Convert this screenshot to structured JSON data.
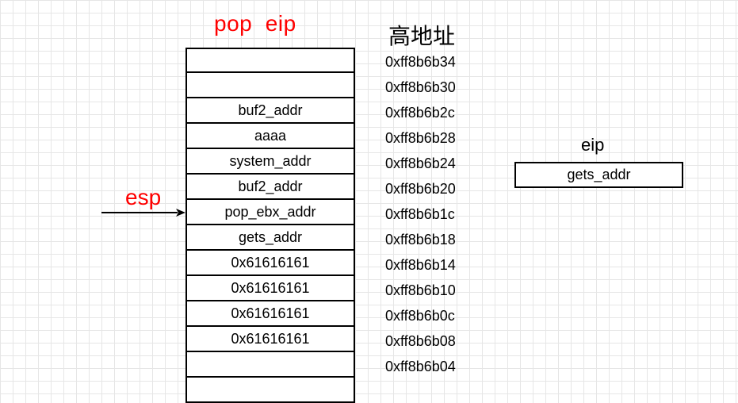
{
  "title_left": "pop  eip",
  "title_right": "高地址",
  "stack": {
    "cells": [
      "",
      "",
      "buf2_addr",
      "aaaa",
      "system_addr",
      "buf2_addr",
      "pop_ebx_addr",
      "gets_addr",
      "0x61616161",
      "0x61616161",
      "0x61616161",
      "0x61616161",
      "",
      ""
    ]
  },
  "addresses": [
    "0xff8b6b34",
    "0xff8b6b30",
    "0xff8b6b2c",
    "0xff8b6b28",
    "0xff8b6b24",
    "0xff8b6b20",
    "0xff8b6b1c",
    "0xff8b6b18",
    "0xff8b6b14",
    "0xff8b6b10",
    "0xff8b6b0c",
    "0xff8b6b08",
    "0xff8b6b04"
  ],
  "esp_label": "esp",
  "eip_label": "eip",
  "eip_value": "gets_addr",
  "colors": {
    "accent": "#ff0000",
    "grid": "#e6e6e6",
    "line": "#000000"
  }
}
